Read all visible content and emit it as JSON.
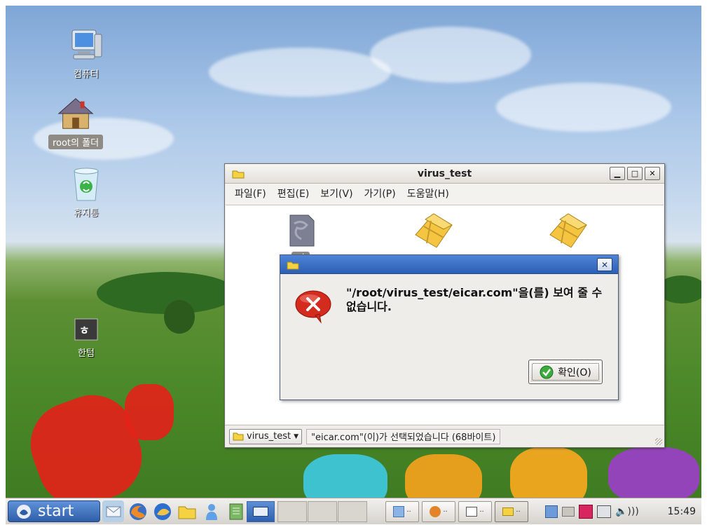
{
  "desktop": {
    "icons": [
      {
        "label": "컴퓨터",
        "icon": "computer-icon"
      },
      {
        "label": "root의 폴더",
        "icon": "home-folder-icon"
      },
      {
        "label": "휴지통",
        "icon": "trash-icon"
      },
      {
        "label": "한텀",
        "icon": "terminal-icon"
      }
    ]
  },
  "file_manager": {
    "title": "virus_test",
    "menu": [
      "파일(F)",
      "편집(E)",
      "보기(V)",
      "가기(P)",
      "도움말(H)"
    ],
    "files": [
      {
        "label": "ei",
        "icon": "unknown-file-icon",
        "selected": true
      },
      {
        "label": "",
        "icon": "package-icon"
      },
      {
        "label": "",
        "icon": "package-icon"
      }
    ],
    "location": "virus_test",
    "status": "\"eicar.com\"(이)가 선택되었습니다 (68바이트)"
  },
  "dialog": {
    "message": "\"/root/virus_test/eicar.com\"을(를) 보여 줄 수 없습니다.",
    "ok_label": "확인(O)"
  },
  "taskbar": {
    "start_label": "start",
    "clock": "15:49"
  },
  "colors": {
    "dialog_title": "#2c5fb6",
    "start_button": "#2e5ea8",
    "error_red": "#d42b1f"
  }
}
